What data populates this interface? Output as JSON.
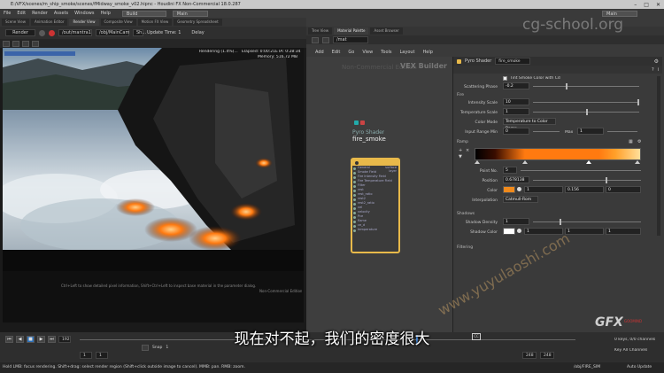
{
  "window": {
    "path": "E:/VFX/scenes/m_ship_smoke/scenes/fMidway_smoke_v02.hipnc - Houdini FX Non-Commercial 18.0.287",
    "build_desk": "Build",
    "main_desk_left": "Main",
    "main_desk_right": "Main"
  },
  "menu": [
    "File",
    "Edit",
    "Render",
    "Assets",
    "Windows",
    "Help"
  ],
  "left_tabs": [
    "Scene View",
    "Animation Editor",
    "Render View",
    "Composite View",
    "Motion FX View",
    "Geometry Spreadsheet"
  ],
  "left_toolbar": {
    "render_label": "Render",
    "out_path": "/out/mantra1",
    "cam_path": "/obj/MainCam",
    "shading_label": "Sh...",
    "update_label": "Update Time: 1",
    "delay_label": "Delay"
  },
  "render_view": {
    "status": "Rendering (1.4%)...",
    "elapsed": "Elapsed: 0:00:21",
    "eta": "ETA: 0:28:34",
    "memory": "Memory: 516.72 MB",
    "hint": "Ctrl+Left to show detailed pixel information, Shift+Ctrl+Left to inspect base material in the parameter dialog.",
    "edition": "Non-Commercial Edition"
  },
  "right_tabs": [
    "Tree View",
    "Material Palette",
    "Asset Browser"
  ],
  "right_path": "/mat",
  "network_menu": [
    "Add",
    "Edit",
    "Go",
    "View",
    "Tools",
    "Layout",
    "Help"
  ],
  "network": {
    "noncommercial": "Non-Commercial Edition",
    "builder": "VEX Builder",
    "node_type": "Pyro Shader",
    "node_name": "fire_smoke",
    "inputs": [
      "General",
      "Smoke Field",
      "Fire Intensity Field",
      "Fire Temperature Field",
      "Filter",
      "rest",
      "rest_ratio",
      "rest2",
      "rest2_ratio",
      "vel",
      "velocity",
      "Pce",
      "flame",
      "ce_d",
      "temperature"
    ],
    "outputs": [
      "surface",
      "layer"
    ]
  },
  "params": {
    "header_type": "Pyro Shader",
    "header_name": "fire_smoke",
    "tint_label": "Tint Smoke Color with Cd",
    "scattering_phase_label": "Scattering Phase",
    "scattering_phase": "-0.2",
    "fire_section": "Fire",
    "intensity_scale_label": "Intensity Scale",
    "intensity_scale": "10",
    "temperature_scale_label": "Temperature Scale",
    "temperature_scale": "1",
    "color_mode_label": "Color Mode",
    "color_mode": "Temperature to Color Ramp",
    "input_range_label": "Input Range Min",
    "input_range_min": "0",
    "input_range_max_label": "Max",
    "input_range_max": "1",
    "ramp_section": "Ramp",
    "point_no_label": "Point No.",
    "point_no": "5",
    "position_label": "Position",
    "position": "0.678138",
    "color_label": "Color",
    "color_r": "1",
    "color_g": "0.156",
    "color_b": "0",
    "interp_label": "Interpolation",
    "interp": "Catmull-Rom",
    "shadows_section": "Shadows",
    "shadow_density_label": "Shadow Density",
    "shadow_density": "1",
    "shadow_color_label": "Shadow Color",
    "shadow_color_r": "1",
    "shadow_color_g": "1",
    "shadow_color_b": "1",
    "filtering_section": "Filtering",
    "swatch_color": "#f08a1c"
  },
  "timeline": {
    "frame": "192",
    "snap": "Snap",
    "snap_value": "1",
    "start": "1",
    "start2": "1",
    "end": "248",
    "end2": "248",
    "keys": "0 keys, 0/0 channels",
    "key_all": "Key All Channels",
    "auto_update": "Auto Update",
    "obj_path": "/obj/FIRE_SIM"
  },
  "status_text": "Hold LMB: focus rendering. Shift+drag: select render region (Shift+click outside image to cancel). MMB: pan. RMB: zoom.",
  "subtitle": "现在对不起，我们的密度很大",
  "watermarks": {
    "top": "cg-school.org",
    "diag": "www.yuyulaoshi.com",
    "logo": "GFX",
    "logo_sub": "GOOMIND"
  },
  "colors": {
    "node_border": "#e8b94a",
    "ramp_orange": "#ff7a10"
  }
}
